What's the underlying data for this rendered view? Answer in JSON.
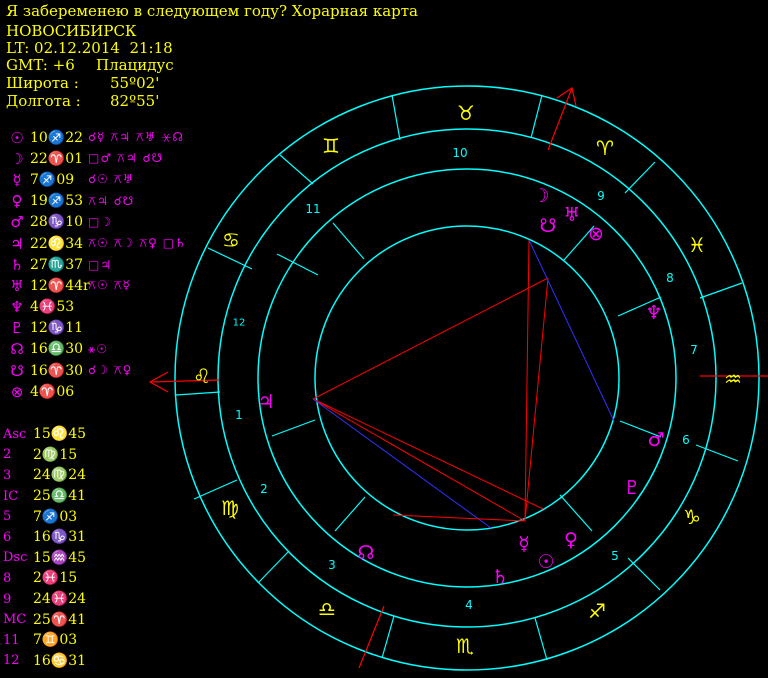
{
  "header": {
    "title": "Я забеременею в следующем году? Хорарная карта",
    "city": "НОВОСИБИРСК",
    "lt": "LT: 02.12.2014  21:18",
    "gmt": "GMT: +6",
    "system": "Плацидус",
    "lat_label": "Широта :",
    "lat_value": "55º02'",
    "lon_label": "Долгота :",
    "lon_value": "82º55'"
  },
  "planets": [
    {
      "glyph": "☉",
      "pos": "10♐22",
      "aspects": "☌☿ ⚻♃ ⚻♅ ⚹☊"
    },
    {
      "glyph": "☽",
      "pos": "22♈01",
      "aspects": "□♂ ⚻♃ ☌☋"
    },
    {
      "glyph": "☿",
      "pos": "7♐09",
      "aspects": "☌☉ ⚻♅"
    },
    {
      "glyph": "♀",
      "pos": "19♐53",
      "aspects": "⚻♃ ☌☋"
    },
    {
      "glyph": "♂",
      "pos": "28♑10",
      "aspects": "□☽"
    },
    {
      "glyph": "♃",
      "pos": "22♌34",
      "aspects": "⚻☉ ⚻☽ ⚻♀ □♄"
    },
    {
      "glyph": "♄",
      "pos": "27♏37",
      "aspects": "□♃"
    },
    {
      "glyph": "♅",
      "pos": "12♈44r",
      "aspects": "⚻☉ ⚻☿"
    },
    {
      "glyph": "♆",
      "pos": "4♓53",
      "aspects": ""
    },
    {
      "glyph": "♇",
      "pos": "12♑11",
      "aspects": ""
    },
    {
      "glyph": "☊",
      "pos": "16♎30",
      "aspects": "⚹☉"
    },
    {
      "glyph": "☋",
      "pos": "16♈30",
      "aspects": "☌☽ ⚻♀"
    },
    {
      "glyph": "⊗",
      "pos": "4♈06",
      "aspects": ""
    }
  ],
  "houses": [
    {
      "label": "Asc",
      "pos": "15♌45"
    },
    {
      "label": "2",
      "pos": "2♍15"
    },
    {
      "label": "3",
      "pos": "24♍24"
    },
    {
      "label": "IC",
      "pos": "25♎41"
    },
    {
      "label": "5",
      "pos": "7♐03"
    },
    {
      "label": "6",
      "pos": "16♑31"
    },
    {
      "label": "Dsc",
      "pos": "15♒45"
    },
    {
      "label": "8",
      "pos": "2♓15"
    },
    {
      "label": "9",
      "pos": "24♓24"
    },
    {
      "label": "MC",
      "pos": "25♈41"
    },
    {
      "label": "11",
      "pos": "7♊03"
    },
    {
      "label": "12",
      "pos": "16♋31"
    }
  ],
  "chart": {
    "zodiac_glyphs": [
      "♈",
      "♉",
      "♊",
      "♋",
      "♌",
      "♍",
      "♎",
      "♏",
      "♐",
      "♑",
      "♒",
      "♓"
    ],
    "house_numbers": [
      "1",
      "2",
      "3",
      "4",
      "5",
      "6",
      "7",
      "8",
      "9",
      "10",
      "11",
      "12"
    ],
    "colors": {
      "ring": "#00ffff",
      "text": "#ffff00",
      "planet": "#ff00ff",
      "red": "#ff0000",
      "blue": "#3030ff"
    }
  }
}
